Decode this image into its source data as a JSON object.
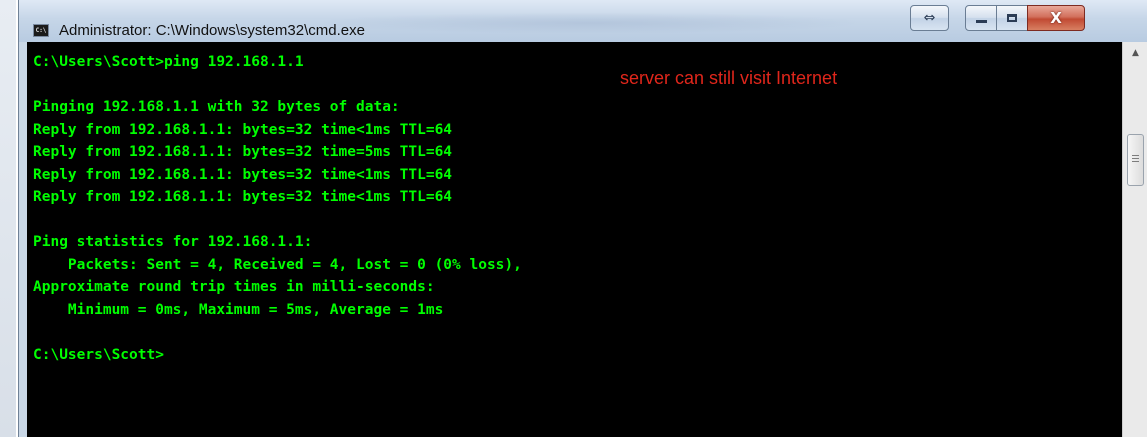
{
  "window": {
    "title": "Administrator: C:\\Windows\\system32\\cmd.exe",
    "icon": "cmd-icon",
    "icon_text": "C:\\",
    "controls": {
      "snap_icon": "resize-arrows-icon",
      "snap_glyph": "⇔",
      "minimize_icon": "minimize-icon",
      "maximize_icon": "maximize-icon",
      "close_icon": "close-icon",
      "close_glyph": "X"
    }
  },
  "console": {
    "lines": [
      "C:\\Users\\Scott>ping 192.168.1.1",
      "",
      "Pinging 192.168.1.1 with 32 bytes of data:",
      "Reply from 192.168.1.1: bytes=32 time<1ms TTL=64",
      "Reply from 192.168.1.1: bytes=32 time=5ms TTL=64",
      "Reply from 192.168.1.1: bytes=32 time<1ms TTL=64",
      "Reply from 192.168.1.1: bytes=32 time<1ms TTL=64",
      "",
      "Ping statistics for 192.168.1.1:",
      "    Packets: Sent = 4, Received = 4, Lost = 0 (0% loss),",
      "Approximate round trip times in milli-seconds:",
      "    Minimum = 0ms, Maximum = 5ms, Average = 1ms",
      "",
      "C:\\Users\\Scott>"
    ],
    "text_color": "#00ff00",
    "background": "#000000"
  },
  "annotation": {
    "text": "server can still visit Internet",
    "color": "#e0261b"
  },
  "scrollbar": {
    "up_icon": "scroll-up-arrow-icon",
    "up_glyph": "▲",
    "thumb_icon": "scroll-grip-icon"
  }
}
